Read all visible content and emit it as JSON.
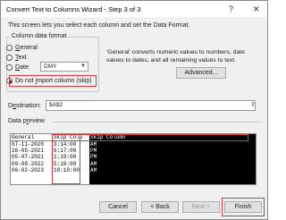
{
  "window": {
    "title": "Convert Text to Columns Wizard - Step 3 of 3",
    "help_glyph": "?",
    "close_glyph": "✕"
  },
  "intro": "This screen lets you select each column and set the Data Format.",
  "column_format": {
    "legend": "Column data format",
    "options": [
      {
        "pre": "",
        "key": "G",
        "rest": "eneral",
        "selected": false
      },
      {
        "pre": "",
        "key": "T",
        "rest": "ext",
        "selected": false
      },
      {
        "pre": "",
        "key": "D",
        "rest": "ate:",
        "selected": false
      },
      {
        "pre": "Do not ",
        "key": "i",
        "rest": "mport column (skip)",
        "selected": true
      }
    ],
    "date_value": "DMY"
  },
  "general_note": "'General' converts numeric values to numbers, date values to dates, and all remaining values to text.",
  "advanced_button": "Advanced...",
  "destination": {
    "label_pre": "D",
    "label_key": "e",
    "label_rest": "stination:",
    "value": "$A$2"
  },
  "preview": {
    "label_pre": "Data p",
    "label_key": "r",
    "label_rest": "eview",
    "headers": [
      "General",
      "Skip Colu",
      "Skip Column"
    ],
    "rows": [
      [
        "07-11-2020",
        "3:14:00",
        "AM"
      ],
      [
        "16-05-2021",
        "6:17:00",
        "PM"
      ],
      [
        "05-07-2021",
        "1:19:00",
        "PM"
      ],
      [
        "09-08-2022",
        "5:18:00",
        "AM"
      ],
      [
        "06-02-2023",
        "10:10:00",
        "AM"
      ]
    ]
  },
  "buttons": {
    "cancel": "Cancel",
    "back": "< Back",
    "next": "Next >",
    "finish": "Finish"
  },
  "colors": {
    "highlight": "#d9363e",
    "preview_bg": "#000000"
  }
}
